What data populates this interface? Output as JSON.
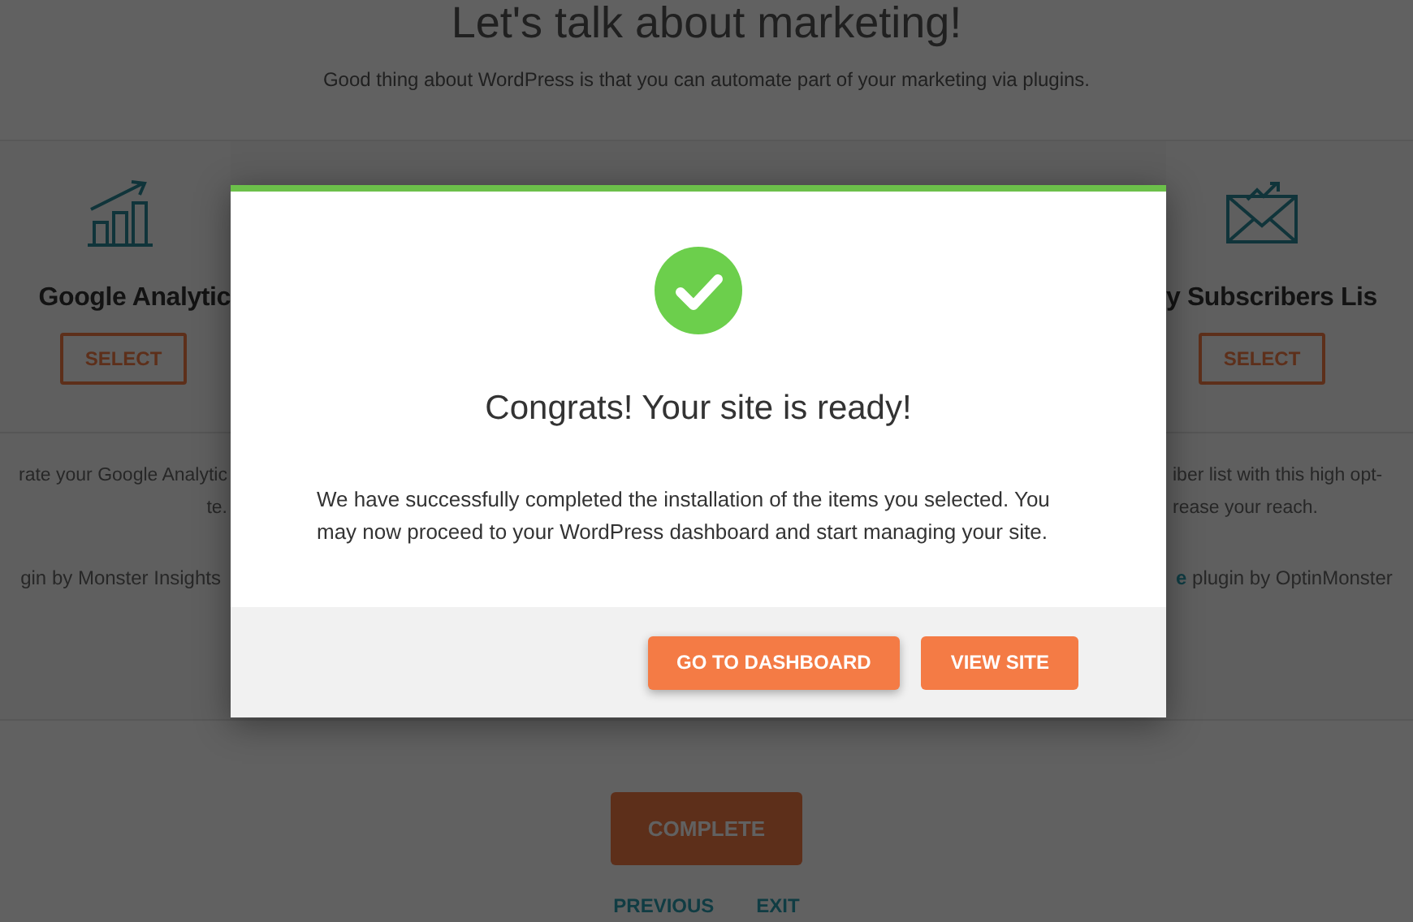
{
  "page": {
    "title": "Let's talk about marketing!",
    "subtitle": "Good thing about WordPress is that you can automate part of your marketing via plugins."
  },
  "cards": [
    {
      "kind": "left",
      "title": "Google Analytic",
      "button": "SELECT",
      "description": [
        "rate your Google Analytic",
        "te."
      ],
      "plugin_text": "gin by Monster Insights"
    },
    {
      "kind": "right",
      "title": "y Subscribers Lis",
      "button": "SELECT",
      "description": [
        "iber list with this high opt-",
        "rease your reach."
      ],
      "plugin_link": "e",
      "plugin_text": "plugin by OptinMonster"
    }
  ],
  "complete_button": "COMPLETE",
  "nav_links": [
    "PREVIOUS",
    "EXIT"
  ],
  "modal": {
    "title": "Congrats! Your site is ready!",
    "message": "We have successfully completed the installation of the items you selected. You may now proceed to your WordPress dashboard and start managing your site.",
    "buttons": [
      "GO TO DASHBOARD",
      "VIEW SITE"
    ]
  }
}
